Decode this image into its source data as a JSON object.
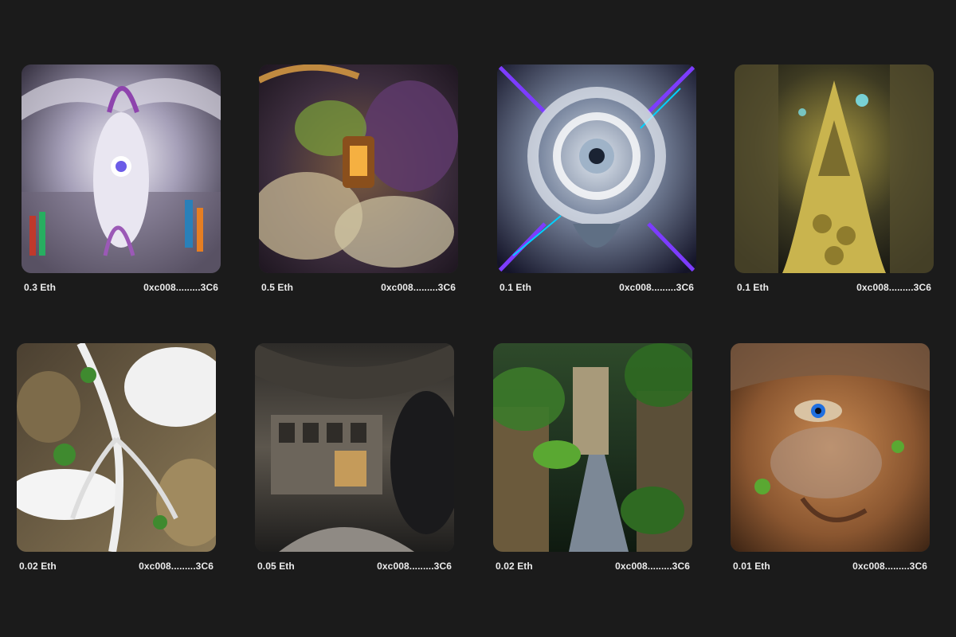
{
  "cards": [
    {
      "price": "0.3 Eth",
      "address": "0xc008.........3C6",
      "art": "white-purple-crystal-cathedral"
    },
    {
      "price": "0.5 Eth",
      "address": "0xc008.........3C6",
      "art": "fractal-temple-lantern"
    },
    {
      "price": "0.1 Eth",
      "address": "0xc008.........3C6",
      "art": "glass-flower-portal"
    },
    {
      "price": "0.1 Eth",
      "address": "0xc008.........3C6",
      "art": "golden-fractal-tree"
    },
    {
      "price": "0.02 Eth",
      "address": "0xc008.........3C6",
      "art": "white-coral-roots-cave"
    },
    {
      "price": "0.05 Eth",
      "address": "0xc008.........3C6",
      "art": "stone-cave-city"
    },
    {
      "price": "0.02 Eth",
      "address": "0xc008.........3C6",
      "art": "jungle-city-river"
    },
    {
      "price": "0.01 Eth",
      "address": "0xc008.........3C6",
      "art": "ornate-bronze-face"
    }
  ]
}
